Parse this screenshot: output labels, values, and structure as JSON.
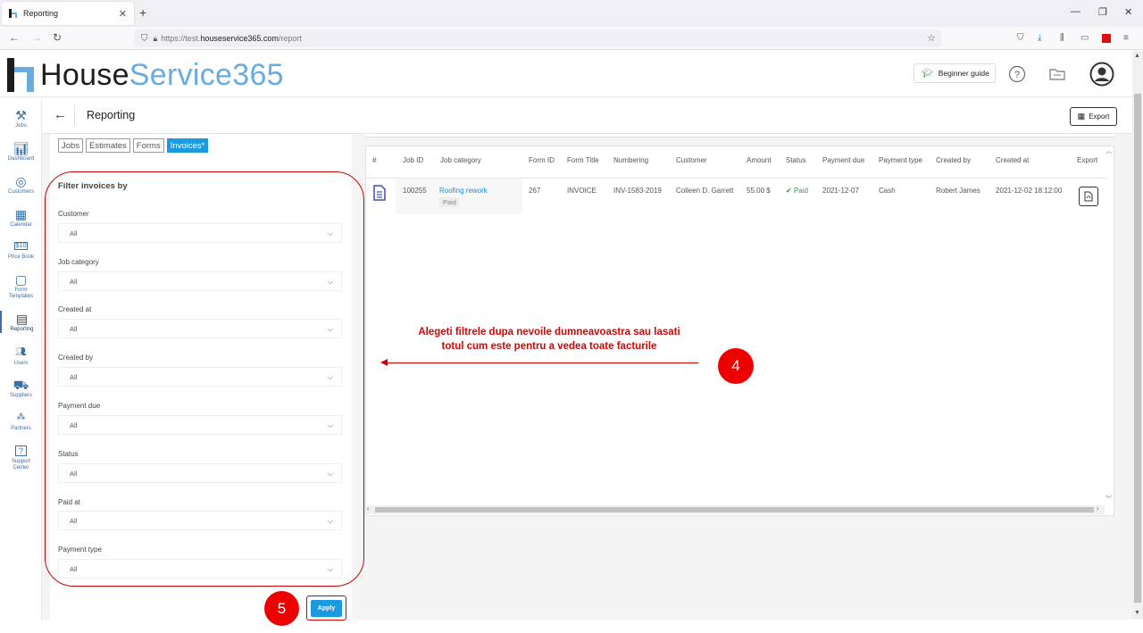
{
  "browser": {
    "tab_title": "Reporting",
    "url_prefix": "https://test.",
    "url_domain": "houseservice365.com",
    "url_path": "/report"
  },
  "app": {
    "logo_part1": "House",
    "logo_part2": "Service365",
    "beginner_guide": "Beginner guide"
  },
  "sidebar": {
    "items": [
      {
        "label": "Jobs",
        "icon": "tools-icon"
      },
      {
        "label": "Dashboard",
        "icon": "chart-icon"
      },
      {
        "label": "Customers",
        "icon": "customers-icon"
      },
      {
        "label": "Calendar",
        "icon": "calendar-icon"
      },
      {
        "label": "Price Book",
        "icon": "price-book-icon"
      },
      {
        "label": "Form",
        "label2": "Templates",
        "icon": "form-templates-icon"
      },
      {
        "label": "Reporting",
        "icon": "reporting-icon"
      },
      {
        "label": "Users",
        "icon": "users-icon"
      },
      {
        "label": "Suppliers",
        "icon": "suppliers-icon"
      },
      {
        "label": "Partners",
        "icon": "partners-icon"
      },
      {
        "label": "Support",
        "label2": "Center",
        "icon": "support-icon"
      }
    ]
  },
  "page": {
    "title": "Reporting",
    "export_label": "Export"
  },
  "report_types": [
    "Jobs",
    "Estimates",
    "Forms",
    "Invoices*"
  ],
  "filters": {
    "title": "Filter invoices by",
    "fields": [
      {
        "label": "Customer",
        "value": "All"
      },
      {
        "label": "Job category",
        "value": "All"
      },
      {
        "label": "Created at",
        "value": "All"
      },
      {
        "label": "Created by",
        "value": "All"
      },
      {
        "label": "Payment due",
        "value": "All"
      },
      {
        "label": "Status",
        "value": "All"
      },
      {
        "label": "Paid at",
        "value": "All"
      },
      {
        "label": "Payment type",
        "value": "All"
      }
    ],
    "apply_label": "Apply"
  },
  "annotation": {
    "text_line1": "Alegeti filtrele dupa nevoile dumneavoastra sau lasati",
    "text_line2": "totul cum este pentru a vedea toate facturile",
    "badge_4": "4",
    "badge_5": "5",
    "color": "#e00000"
  },
  "table": {
    "columns": [
      "#",
      "Job ID",
      "Job category",
      "Form ID",
      "Form Title",
      "Numbering",
      "Customer",
      "Amount",
      "Status",
      "Payment due",
      "Payment type",
      "Created by",
      "Created at",
      "Export"
    ],
    "rows": [
      {
        "job_id": "100255",
        "job_category": "Roofing rework",
        "job_tag": "Paid",
        "form_id": "267",
        "form_title": "INVOICE",
        "numbering": "INV-1583-2019",
        "customer": "Colleen D. Garrett",
        "amount": "55.00 $",
        "status": "Paid",
        "payment_due": "2021-12-07",
        "payment_type": "Cash",
        "created_by": "Robert James",
        "created_at": "2021-12-02 18:12:00"
      }
    ]
  },
  "colors": {
    "accent": "#1a9ae0",
    "brand_blue": "#6aabe0",
    "nav_blue": "#3b6ea5",
    "paid_green": "#2d9b57"
  }
}
